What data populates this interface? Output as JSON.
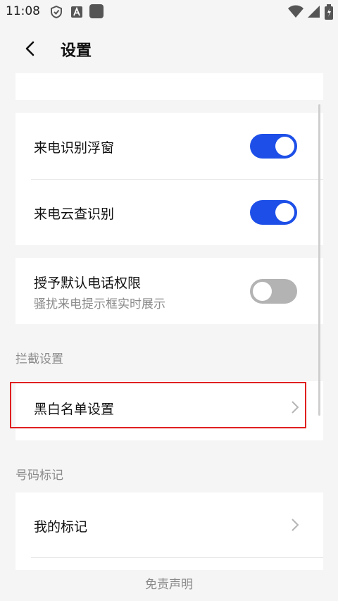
{
  "status_bar": {
    "time": "11:08",
    "icons": [
      "shield-icon",
      "a-icon",
      "app-square-icon",
      "wifi-icon",
      "cellular-icon",
      "battery-icon"
    ]
  },
  "header": {
    "title": "设置"
  },
  "call_settings": {
    "items": [
      {
        "label": "来电识别浮窗",
        "enabled": true
      },
      {
        "label": "来电云查识别",
        "enabled": true
      }
    ]
  },
  "permission": {
    "label": "授予默认电话权限",
    "sublabel": "骚扰来电提示框实时展示",
    "enabled": false
  },
  "intercept": {
    "section_title": "拦截设置",
    "item_label": "黑白名单设置"
  },
  "marking": {
    "section_title": "号码标记",
    "item_label": "我的标记"
  },
  "footer": {
    "link": "免责声明"
  },
  "colors": {
    "accent": "#1d4fe8",
    "toggle_off": "#b3b3b3",
    "highlight": "#e02020"
  }
}
